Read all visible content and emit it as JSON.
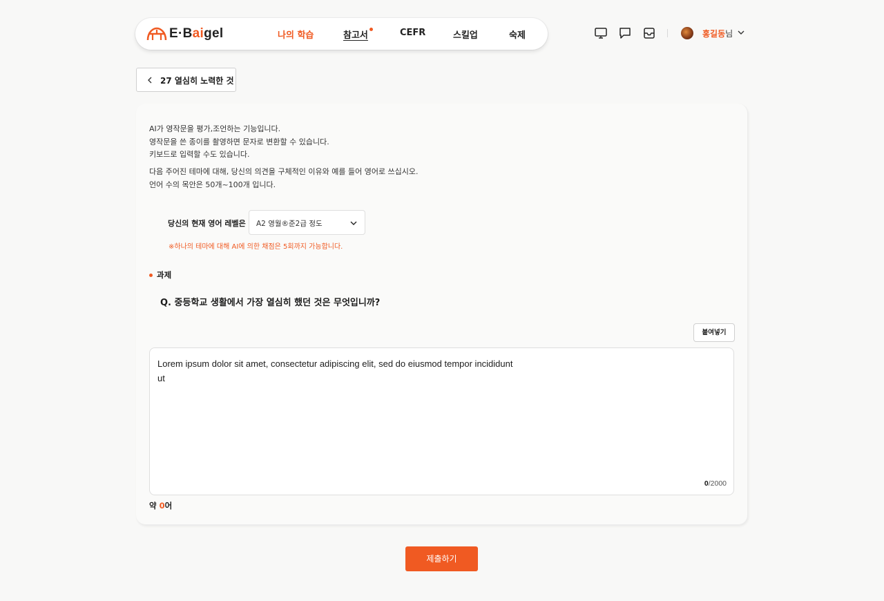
{
  "brand": {
    "logo_prefix": "E·B",
    "logo_accent": "ai",
    "logo_suffix": "gel",
    "accent_color": "#f05a22"
  },
  "nav": {
    "items": [
      {
        "label": "나의 학습",
        "active": true
      },
      {
        "label": "참고서",
        "has_notification": true
      },
      {
        "label": "CEFR"
      },
      {
        "label": "스킬업"
      },
      {
        "label": "숙제"
      }
    ]
  },
  "header_icons": [
    "monitor-icon",
    "chat-icon",
    "inbox-icon"
  ],
  "user": {
    "name": "홍길동",
    "honorific": "님",
    "dropdown_icon": "chevron-down-icon"
  },
  "back": {
    "label": "27 열심히 노력한 것",
    "icon": "chevron-left-icon"
  },
  "intro": {
    "lines": [
      "AI가 영작문을 평가,조언하는 기능입니다.",
      "영작문을 쓴 종이를 촬영하면 문자로 변환할 수 있습니다.",
      "키보드로 입력할 수도 있습니다."
    ],
    "instructions": [
      "다음 주어진 테마에 대해, 당신의 의견을 구체적인 이유와 예를 들어 영어로 쓰십시오.",
      "언어 수의 목안은 50개~100개 입니다."
    ]
  },
  "level": {
    "label": "당신의 현재 영어 레벨은",
    "selected": "A2 영월®준2급 정도",
    "notice": "※하나의 테마에 대해 AI에 의한 채점은 5회까지 가능합니다."
  },
  "task": {
    "title": "과제",
    "question": "Q. 중등학교 생활에서 가장 열심히 했던 것은 무엇입니까?"
  },
  "editor": {
    "paste_label": "붙여넣기",
    "text": "Lorem ipsum dolor sit amet, consectetur adipiscing elit, sed do eiusmod tempor incididunt ut",
    "count_current": "0",
    "count_max": "/2000",
    "approx_prefix": "약 ",
    "approx_num": "0",
    "approx_suffix": "어"
  },
  "submit_label": "제출하기"
}
